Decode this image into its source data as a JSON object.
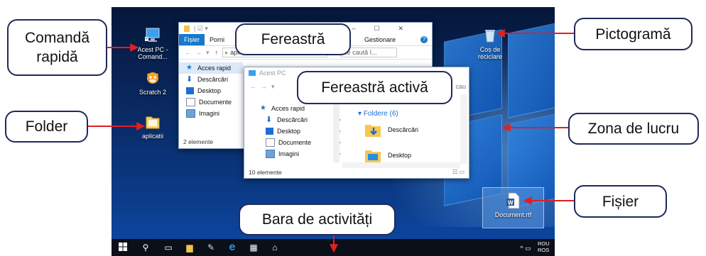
{
  "callouts": {
    "shortcut": "Comandă\nrapidă",
    "window": "Fereastră",
    "active_window": "Fereastră activă",
    "icon": "Pictogramă",
    "folder": "Folder",
    "desktop_area": "Zona de lucru",
    "file": "Fișier",
    "taskbar": "Bara de activități"
  },
  "desktop": {
    "icons": {
      "this_pc": "Acest PC -\nComand...",
      "scratch": "Scratch 2",
      "aplicatii": "aplicatii",
      "recycle_bin": "Coș de\nreciclare",
      "document": "Document.rtf"
    }
  },
  "window_back": {
    "tabs": [
      "Fișier",
      "Porni"
    ],
    "manage_tab": "Gestionare",
    "address": "aplicatii",
    "search_placeholder": "Se caută î...",
    "nav": [
      "Acces rapid",
      "Descărcări",
      "Desktop",
      "Documente",
      "Imagini"
    ],
    "status": "2 elemente"
  },
  "window_front": {
    "title": "Acest PC",
    "address_tail": "cau",
    "nav": [
      "Acces rapid",
      "Descărcări",
      "Desktop",
      "Documente",
      "Imagini"
    ],
    "group_header": "Foldere (6)",
    "folders": [
      "Descărcări",
      "Desktop"
    ],
    "status": "10 elemente"
  },
  "taskbar": {
    "language_top": "ROU",
    "language_bottom": "ROS"
  },
  "colors": {
    "callout_border": "#1f2a5a",
    "arrow": "#e02020",
    "accent_blue": "#1979ca"
  }
}
